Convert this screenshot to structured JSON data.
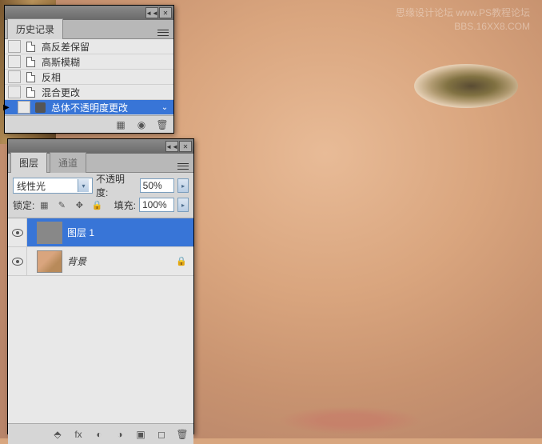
{
  "watermark": {
    "line1": "思缘设计论坛  www.PS教程论坛",
    "line2": "BBS.16XX8.COM"
  },
  "history": {
    "tab": "历史记录",
    "items": [
      {
        "label": "高反差保留",
        "selected": false
      },
      {
        "label": "高斯模糊",
        "selected": false
      },
      {
        "label": "反相",
        "selected": false
      },
      {
        "label": "混合更改",
        "selected": false
      },
      {
        "label": "总体不透明度更改",
        "selected": true
      }
    ]
  },
  "layers": {
    "tabs": {
      "active": "图层",
      "inactive": "通道"
    },
    "blend_mode": "线性光",
    "opacity_label": "不透明度:",
    "opacity_value": "50%",
    "lock_label": "锁定:",
    "fill_label": "填充:",
    "fill_value": "100%",
    "items": [
      {
        "name": "图层 1",
        "selected": true,
        "locked": false
      },
      {
        "name": "背景",
        "selected": false,
        "locked": true
      }
    ]
  }
}
